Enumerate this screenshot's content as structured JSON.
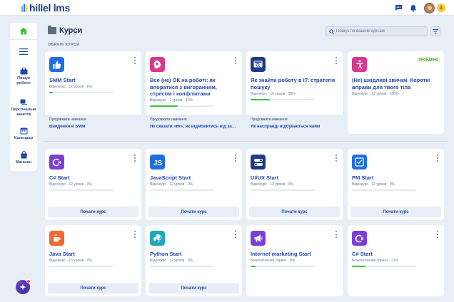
{
  "app": {
    "logo_hillel": "hillel",
    "logo_lms": "lms",
    "coins": "3"
  },
  "colors": {
    "accent": "#2147a8",
    "progress": "#3cc436",
    "panel": "#e7eef7"
  },
  "sidebar": {
    "items": [
      {
        "label": "Пошук роботи",
        "icon": "briefcase-icon"
      },
      {
        "label": "Персональні заняття",
        "icon": "chat-icon"
      },
      {
        "label": "Календар",
        "icon": "calendar-icon"
      },
      {
        "label": "Магазин",
        "icon": "shop-icon"
      }
    ]
  },
  "header": {
    "title": "Курси",
    "search_placeholder": "Пошук по вашим курсам"
  },
  "section_label": "ОБРАНІ КУРСИ",
  "favorites": [
    {
      "title": "SMM Start",
      "meta": "Відеокурс · 12 уроків · 6%",
      "progress": 0.06,
      "continue_label": "Продовжити навчання",
      "continue_value": "Введення в SMM",
      "icon": "thumbs-up-icon",
      "icon_color": "#1f6fe0"
    },
    {
      "title": "Все (не) ОК на роботі: як впоратися з вигоранням, стресом і конфліктами",
      "meta": "Відеокурс · 7 уроків · 43%",
      "progress": 0.43,
      "continue_label": "Продовжити навчання",
      "continue_value": "Як сказати «Ні»: як відмовитись від зайвих задач",
      "icon": "brain-icon",
      "icon_color": "#d63a8e"
    },
    {
      "title": "Як знайти роботу в IT: стратегія пошуку",
      "meta": "Відеокурс · 10 уроків · 30%",
      "progress": 0.3,
      "continue_label": "Продовжити навчання",
      "continue_value": "Як насправді відбувається найм",
      "icon": "job-search-icon",
      "icon_color": "#1d3d8a"
    },
    {
      "title": "(Не) шкідливі звички. Короткі вправи для твого тіла",
      "meta": "Відеокурс · 12 уроків · 100%",
      "progress": 1.0,
      "badge": "ПРОЙДЕНО",
      "icon": "accessibility-icon",
      "icon_color": "#d63a8e"
    }
  ],
  "courses": [
    {
      "title": "C# Start",
      "meta": "Відеокурс · 12 уроків · 0%",
      "progress": 0,
      "button": "Почати курс",
      "icon": "csharp-icon",
      "icon_color": "#7b3fd6"
    },
    {
      "title": "JavaScript Start",
      "meta": "Відеокурс · 12 уроків · 0%",
      "progress": 0,
      "button": "Почати курс",
      "icon": "js-icon",
      "icon_color": "#1f6fe0"
    },
    {
      "title": "UI/UX Start",
      "meta": "Відеокурс · 12 уроків · 0%",
      "progress": 0,
      "button": "Почати курс",
      "icon": "toggle-icon",
      "icon_color": "#1d3d8a"
    },
    {
      "title": "PM Start",
      "meta": "Відеокурс · 12 уроків · 0%",
      "progress": 0,
      "button": "Почати курс",
      "icon": "checklist-icon",
      "icon_color": "#1f6fe0"
    },
    {
      "title": "Java Start",
      "meta": "Відеокурс · 13 уроків · 0%",
      "progress": 0,
      "button": "Почати курс",
      "icon": "coffee-cup-icon",
      "icon_color": "#f26a2e"
    },
    {
      "title": "Python Start",
      "meta": "Відеокурс · 12 уроків · 0%",
      "progress": 0,
      "button": "Почати курс",
      "icon": "python-icon",
      "icon_color": "#1fa8b8"
    },
    {
      "title": "Internet marketing Start",
      "meta": "Безкоштовний спринт · 8%",
      "progress": 0.08,
      "icon": "megaphone-icon",
      "icon_color": "#7b3fd6"
    },
    {
      "title": "C# Start",
      "meta": "Безкоштовний спринт · 21%",
      "progress": 0.21,
      "icon": "csharp-icon",
      "icon_color": "#7b3fd6"
    }
  ]
}
